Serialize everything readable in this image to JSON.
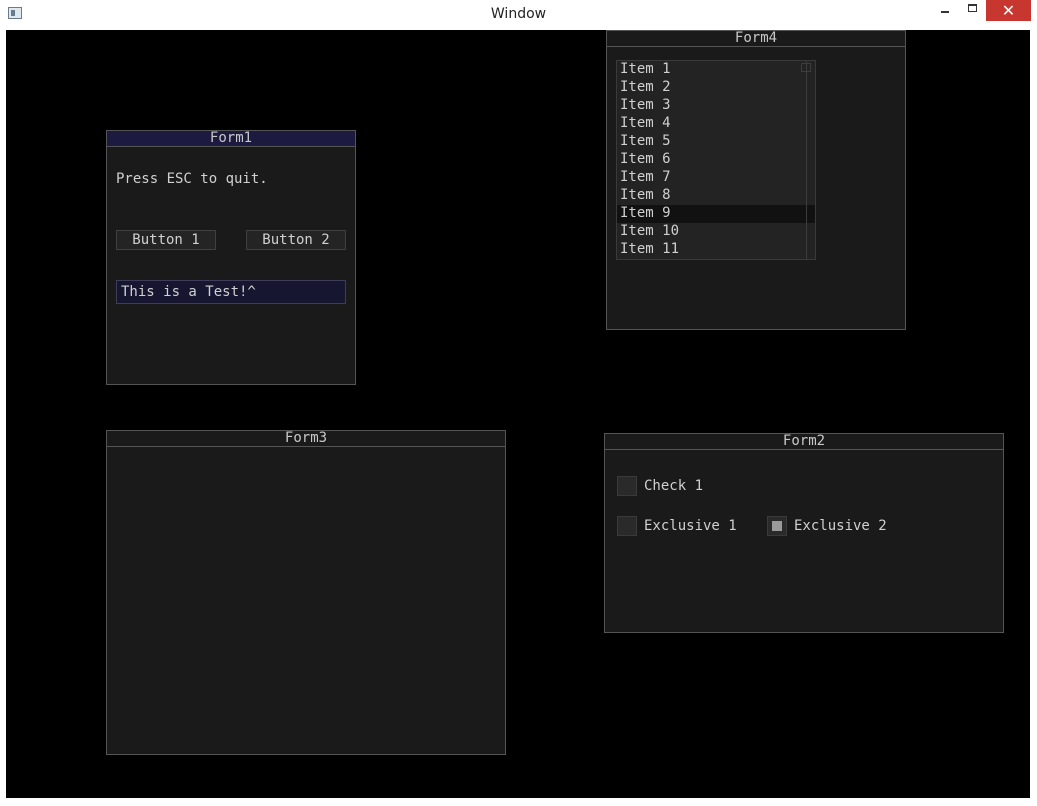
{
  "window": {
    "title": "Window",
    "minimize": "",
    "maximize": "",
    "close": "✕"
  },
  "form1": {
    "title": "Form1",
    "hint": "Press ESC to quit.",
    "button1": "Button 1",
    "button2": "Button 2",
    "text_value": "This is a Test!^"
  },
  "form2": {
    "title": "Form2",
    "check1": "Check 1",
    "exclusive1": "Exclusive 1",
    "exclusive2": "Exclusive 2",
    "check1_checked": false,
    "exclusive1_checked": false,
    "exclusive2_checked": true
  },
  "form3": {
    "title": "Form3"
  },
  "form4": {
    "title": "Form4",
    "items": [
      "Item 1",
      "Item 2",
      "Item 3",
      "Item 4",
      "Item 5",
      "Item 6",
      "Item 7",
      "Item 8",
      "Item 9",
      "Item 10",
      "Item 11"
    ],
    "selected_index": 8
  },
  "colors": {
    "client_background": "#000000",
    "form_background": "#1a1a1a",
    "active_title": "#1c1a3e",
    "close_button": "#c7372f"
  }
}
